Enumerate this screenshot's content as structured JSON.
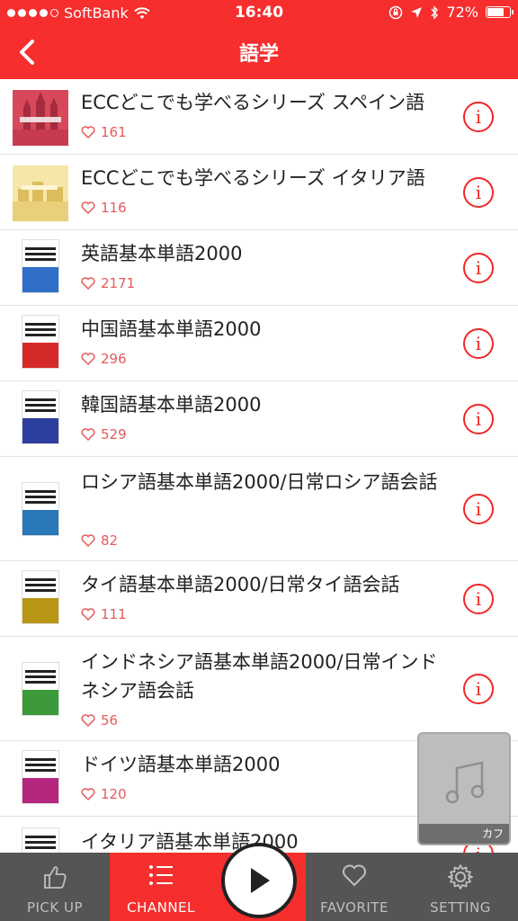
{
  "status": {
    "carrier": "SoftBank",
    "time": "16:40",
    "battery": "72%"
  },
  "nav": {
    "title": "語学"
  },
  "items": [
    {
      "title": "ECCどこでも学べるシリーズ スペイン語",
      "likes": "161"
    },
    {
      "title": "ECCどこでも学べるシリーズ イタリア語",
      "likes": "116"
    },
    {
      "title": "英語基本単語2000",
      "likes": "2171"
    },
    {
      "title": "中国語基本単語2000",
      "likes": "296"
    },
    {
      "title": "韓国語基本単語2000",
      "likes": "529"
    },
    {
      "title": "ロシア語基本単語2000/日常ロシア語会話",
      "likes": "82"
    },
    {
      "title": "タイ語基本単語2000/日常タイ語会話",
      "likes": "111"
    },
    {
      "title": "インドネシア語基本単語2000/日常インドネシア語会話",
      "likes": "56"
    },
    {
      "title": "ドイツ語基本単語2000",
      "likes": "120"
    },
    {
      "title": "イタリア語基本単語2000",
      "likes": ""
    }
  ],
  "info_glyph": "i",
  "mini_player": {
    "caption": "カフ"
  },
  "tabs": {
    "pickup": "PICK UP",
    "channel": "CHANNEL",
    "favorite": "FAVORITE",
    "setting": "SETTING"
  },
  "colors": {
    "accent": "#f62e2e",
    "tabbar": "#555555",
    "likes": "#e8595a"
  }
}
